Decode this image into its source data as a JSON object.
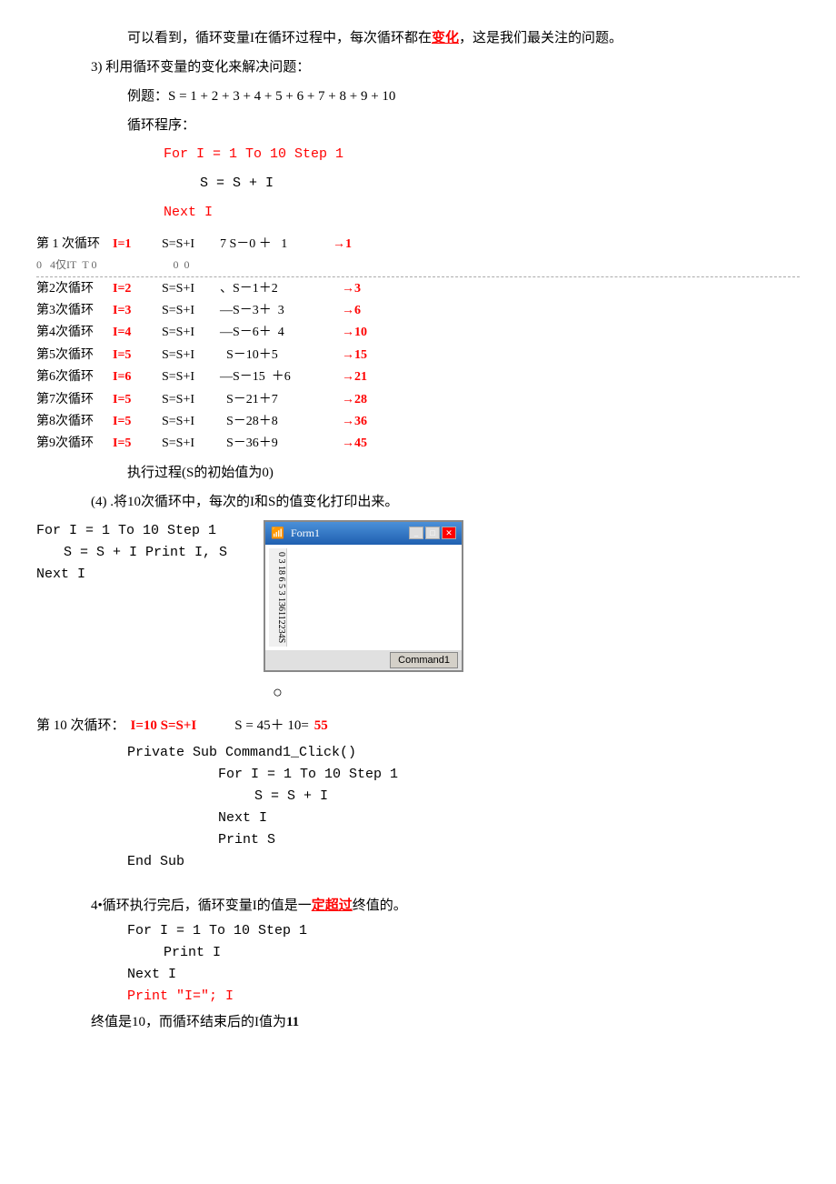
{
  "intro": {
    "line1": "可以看到，循环变量I在循环过程中，每次循环都在",
    "line1_highlight": "变化",
    "line1_end": "，这是我们最关注的问题。",
    "line2": "3) 利用循环变量的变化来解决问题：",
    "example": "例题：S = 1 + 2 + 3 + 4 + 5 + 6 + 7 + 8 + 9 + 10",
    "loop_program": "循环程序：",
    "code1": "For I = 1 To 10 Step 1",
    "code2": "S = S + I",
    "code3": "Next I"
  },
  "loop_table": {
    "row1": {
      "label": "第 1 次循环",
      "var": "I=1",
      "eq": "S=S+I",
      "calc": "7 S－0 ＋",
      "result": "1→1"
    },
    "row_mid": {
      "label": "0    4仅IT   T 0",
      "result": "0  0"
    },
    "row2": {
      "label": "第2次循环",
      "var": "I=2",
      "eq": "S=S+I",
      "calc": "、S－1＋2",
      "result": "→3"
    },
    "row3": {
      "label": "第3次循环",
      "var": "I=3",
      "eq": "S=S+I",
      "calc": "—S－3＋",
      "result": "3→6"
    },
    "row4": {
      "label": "第4次循环",
      "var": "I=4",
      "eq": "S=S+I",
      "calc": "—S－6＋",
      "result": "4→10"
    },
    "row5": {
      "label": "第5次循环",
      "var": "I=5",
      "eq": "S=S+I",
      "calc": "S－10＋5",
      "result": "→15"
    },
    "row6": {
      "label": "第6次循环",
      "var": "I=6",
      "eq": "S=S+I",
      "calc": "—S－15  ＋6",
      "result": "→21"
    },
    "row7": {
      "label": "第7次循环",
      "var": "I=5",
      "eq": "S=S+I",
      "calc": "S－21＋7",
      "result": "→28"
    },
    "row8": {
      "label": "第8次循环",
      "var": "I=5",
      "eq": "S=S+I",
      "calc": "S－28＋8",
      "result": "→36"
    },
    "row9": {
      "label": "第9次循环",
      "var": "I=5",
      "eq": "S=S+I",
      "calc": "S－36＋9",
      "result": "→45"
    }
  },
  "execution_note": "执行过程(S的初始值为0)",
  "section4": {
    "label": "(4)",
    "text": ".将10次循环中，每次的I和S的值变化打印出来。",
    "code1": "For I = 1 To 10 Step 1",
    "code2": "S = S + I Print I, S",
    "code3": "Next I"
  },
  "window": {
    "title": "Form1",
    "values": "0\n3\n18\n6\n5\n3\n136112234S",
    "button": "Command1"
  },
  "circle_char": "○",
  "section10": {
    "text": "第 10 次循环：",
    "vars": "I=10  S=S+I",
    "calc": "S = 45＋ 10=",
    "result": "55",
    "sub_label": "Private Sub Command1_Click()",
    "code1": "For I = 1 To 10 Step 1",
    "code2": "S = S + I",
    "code3": "Next I",
    "code4": "Print S",
    "code5": "End Sub"
  },
  "section4b": {
    "intro": "4•循环执行完后，循环变量I的值是一",
    "highlight1": "定超过",
    "intro2": "终值的。",
    "code1": "For    I = 1 To 10 Step 1",
    "code2": "Print I",
    "code3": "Next I",
    "code4": "Print \"I=\"; I",
    "note1": "终值是10，而循环结束后的I值为",
    "note1_bold": "11"
  }
}
